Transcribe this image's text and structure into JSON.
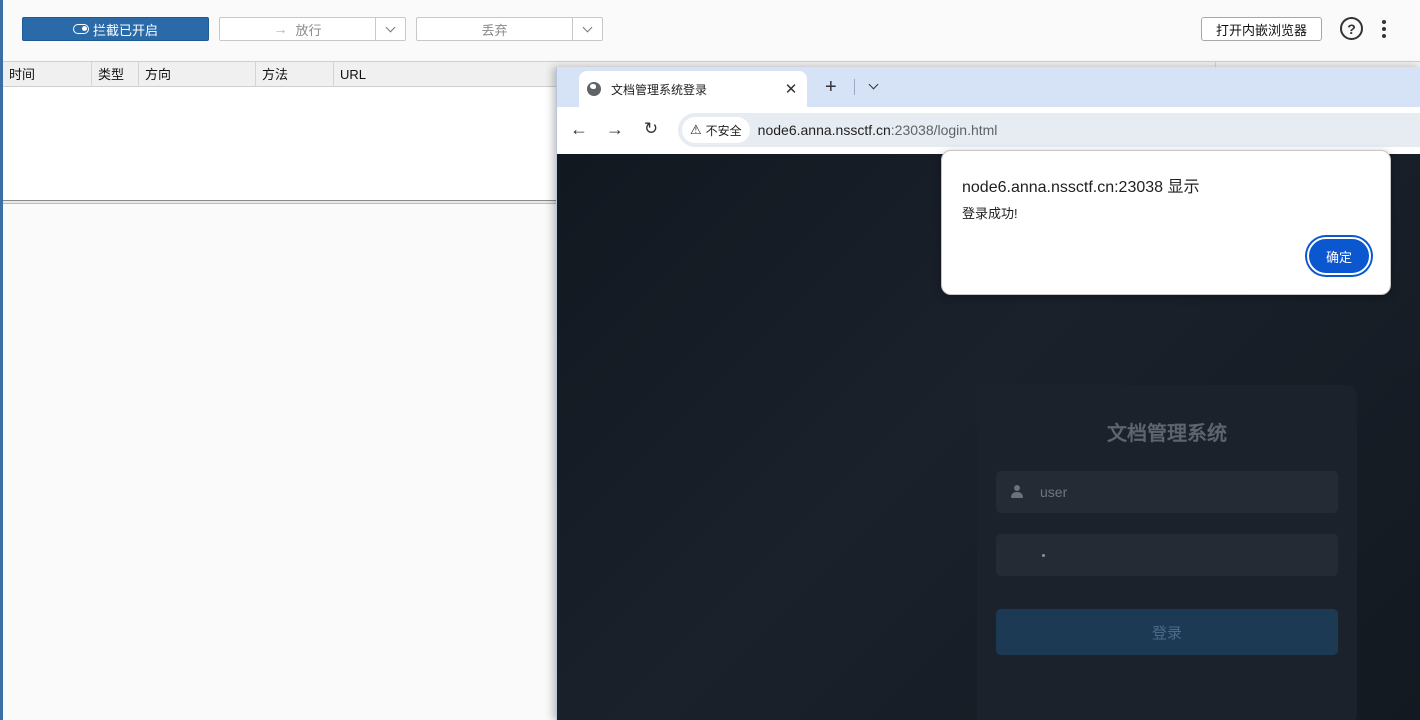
{
  "proxy": {
    "intercept_label": "拦截已开启",
    "forward_label": "放行",
    "drop_label": "丢弃",
    "embedded_browser_label": "打开内嵌浏览器",
    "help_icon": "?",
    "columns": [
      "时间",
      "类型",
      "方向",
      "方法",
      "URL"
    ]
  },
  "browser": {
    "tab_title": "文档管理系统登录",
    "tab_close": "✕",
    "new_tab": "+",
    "security_label": "不安全",
    "url_host": "node6.anna.nssctf.cn",
    "url_rest": ":23038/login.html",
    "accent_color": "#0b57d0"
  },
  "page": {
    "title": "文档管理系统",
    "username_value": "user",
    "login_button": "登录"
  },
  "alert": {
    "title": "node6.anna.nssctf.cn:23038 显示",
    "message": "登录成功!",
    "ok_label": "确定"
  }
}
